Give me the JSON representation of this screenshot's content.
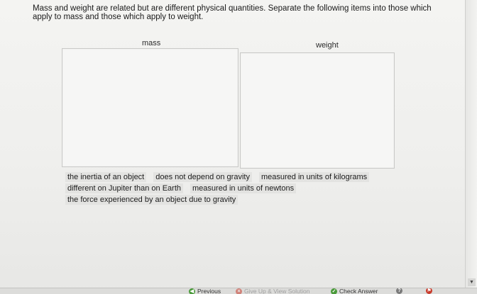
{
  "instructions": "Mass and weight are related but are different physical quantities. Separate the following items into those which apply to mass and those which apply to weight.",
  "zones": {
    "mass_label": "mass",
    "weight_label": "weight"
  },
  "items_row1": [
    "the inertia of an object",
    "does not depend on gravity",
    "measured in units of kilograms"
  ],
  "items_row2": [
    "different on Jupiter than on Earth",
    "measured in units of newtons"
  ],
  "items_row3": [
    "the force experienced by an object due to gravity"
  ],
  "footer": {
    "previous": "Previous",
    "give_up": "Give Up & View Solution",
    "check_answer": "Check Answer"
  }
}
